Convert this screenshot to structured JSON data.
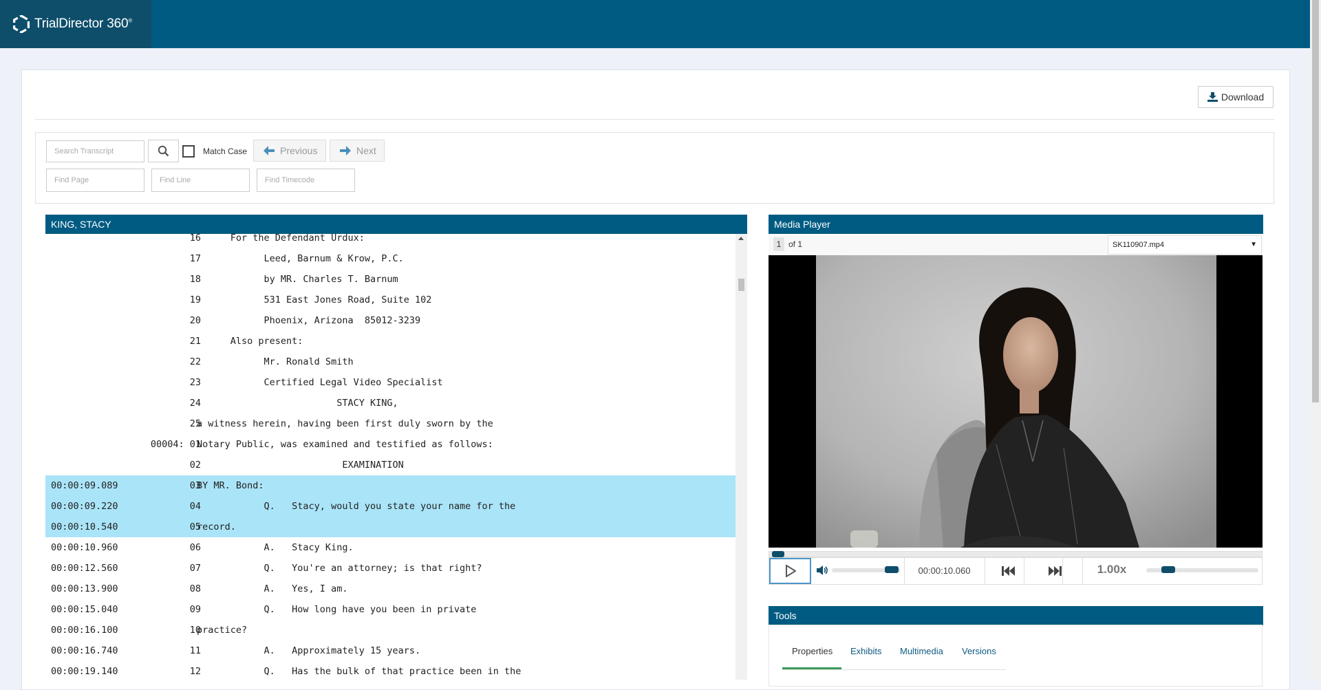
{
  "app": {
    "name": "TrialDirector 360",
    "name_mark": "®"
  },
  "toolbar": {
    "download_label": "Download"
  },
  "search": {
    "transcript_placeholder": "Search Transcript",
    "match_case_label": "Match Case",
    "previous_label": "Previous",
    "next_label": "Next",
    "find_page_placeholder": "Find Page",
    "find_line_placeholder": "Find Line",
    "find_timecode_placeholder": "Find Timecode"
  },
  "transcript": {
    "title": "KING, STACY",
    "lines": [
      {
        "time": "",
        "page_line": "16",
        "text": "      For the Defendant Urdux:",
        "highlight": false
      },
      {
        "time": "",
        "page_line": "17",
        "text": "            Leed, Barnum & Krow, P.C.",
        "highlight": false
      },
      {
        "time": "",
        "page_line": "18",
        "text": "            by MR. Charles T. Barnum",
        "highlight": false
      },
      {
        "time": "",
        "page_line": "19",
        "text": "            531 East Jones Road, Suite 102",
        "highlight": false
      },
      {
        "time": "",
        "page_line": "20",
        "text": "            Phoenix, Arizona  85012-3239",
        "highlight": false
      },
      {
        "time": "",
        "page_line": "21",
        "text": "      Also present:",
        "highlight": false
      },
      {
        "time": "",
        "page_line": "22",
        "text": "            Mr. Ronald Smith",
        "highlight": false
      },
      {
        "time": "",
        "page_line": "23",
        "text": "            Certified Legal Video Specialist",
        "highlight": false
      },
      {
        "time": "",
        "page_line": "24",
        "text": "                         STACY KING,",
        "highlight": false
      },
      {
        "time": "",
        "page_line": "25",
        "text": "a witness herein, having been first duly sworn by the",
        "highlight": false
      },
      {
        "time": "",
        "page_line": "00004: 01",
        "text": "Notary Public, was examined and testified as follows:",
        "highlight": false
      },
      {
        "time": "",
        "page_line": "02",
        "text": "                          EXAMINATION",
        "highlight": false
      },
      {
        "time": "00:00:09.089",
        "page_line": "03",
        "text": "BY MR. Bond:",
        "highlight": true
      },
      {
        "time": "00:00:09.220",
        "page_line": "04",
        "text": "            Q.   Stacy, would you state your name for the",
        "highlight": true
      },
      {
        "time": "00:00:10.540",
        "page_line": "05",
        "text": "record.",
        "highlight": true
      },
      {
        "time": "00:00:10.960",
        "page_line": "06",
        "text": "            A.   Stacy King.",
        "highlight": false
      },
      {
        "time": "00:00:12.560",
        "page_line": "07",
        "text": "            Q.   You're an attorney; is that right?",
        "highlight": false
      },
      {
        "time": "00:00:13.900",
        "page_line": "08",
        "text": "            A.   Yes, I am.",
        "highlight": false
      },
      {
        "time": "00:00:15.040",
        "page_line": "09",
        "text": "            Q.   How long have you been in private",
        "highlight": false
      },
      {
        "time": "00:00:16.100",
        "page_line": "10",
        "text": "practice?",
        "highlight": false
      },
      {
        "time": "00:00:16.740",
        "page_line": "11",
        "text": "            A.   Approximately 15 years.",
        "highlight": false
      },
      {
        "time": "00:00:19.140",
        "page_line": "12",
        "text": "            Q.   Has the bulk of that practice been in the",
        "highlight": false
      }
    ]
  },
  "media_player": {
    "title": "Media Player",
    "page_current": "1",
    "page_of": "of 1",
    "file_name": "SK110907.mp4",
    "current_time": "00:00:10.060",
    "speed": "1.00x",
    "seek_fraction": 0.005,
    "volume_fraction": 0.85,
    "speed_slider_fraction": 0.18
  },
  "tools": {
    "title": "Tools",
    "tabs": [
      {
        "label": "Properties",
        "active": true
      },
      {
        "label": "Exhibits",
        "active": false
      },
      {
        "label": "Multimedia",
        "active": false
      },
      {
        "label": "Versions",
        "active": false
      }
    ]
  },
  "colors": {
    "brand": "#005b82",
    "brand_dark": "#0e4e6b",
    "highlight": "#aae4f8",
    "active_tab": "#3a9a5a"
  }
}
